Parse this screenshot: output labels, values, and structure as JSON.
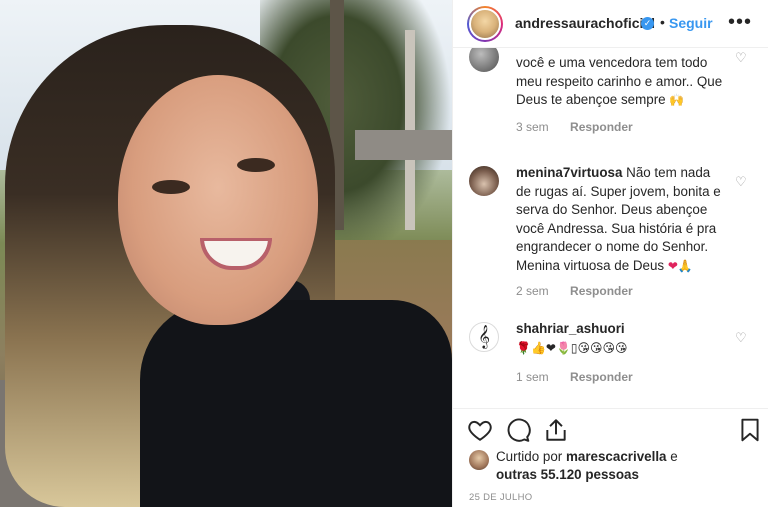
{
  "header": {
    "username": "andressaurachoficial",
    "dot": "•",
    "follow_label": "Seguir",
    "more_label": "•••"
  },
  "comments": [
    {
      "username": "",
      "text": "você e uma vencedora tem todo meu respeito carinho e amor.. Que Deus te abençoe sempre",
      "emoji": "🙌",
      "time": "3 sem",
      "reply_label": "Responder"
    },
    {
      "username": "menina7virtuosa",
      "text": " Não tem nada de rugas aí. Super jovem, bonita e serva do Senhor. Deus abençoe você Andressa. Sua história é pra engrandecer o nome do Senhor. Menina virtuosa de Deus",
      "emoji": "❤🙏",
      "time": "2 sem",
      "reply_label": "Responder"
    },
    {
      "username": "shahriar_ashuori",
      "emojis": "🌹👍❤🌷▯😘😘😘😘",
      "time": "1 sem",
      "reply_label": "Responder"
    }
  ],
  "icons": {
    "like": "heart-icon",
    "comment": "comment-icon",
    "share": "share-icon",
    "save": "bookmark-icon"
  },
  "likes": {
    "prefix": "Curtido por ",
    "liker": "marescacrivella",
    "mid": " e ",
    "others": "outras 55.120 pessoas"
  },
  "date": "25 DE JULHO"
}
